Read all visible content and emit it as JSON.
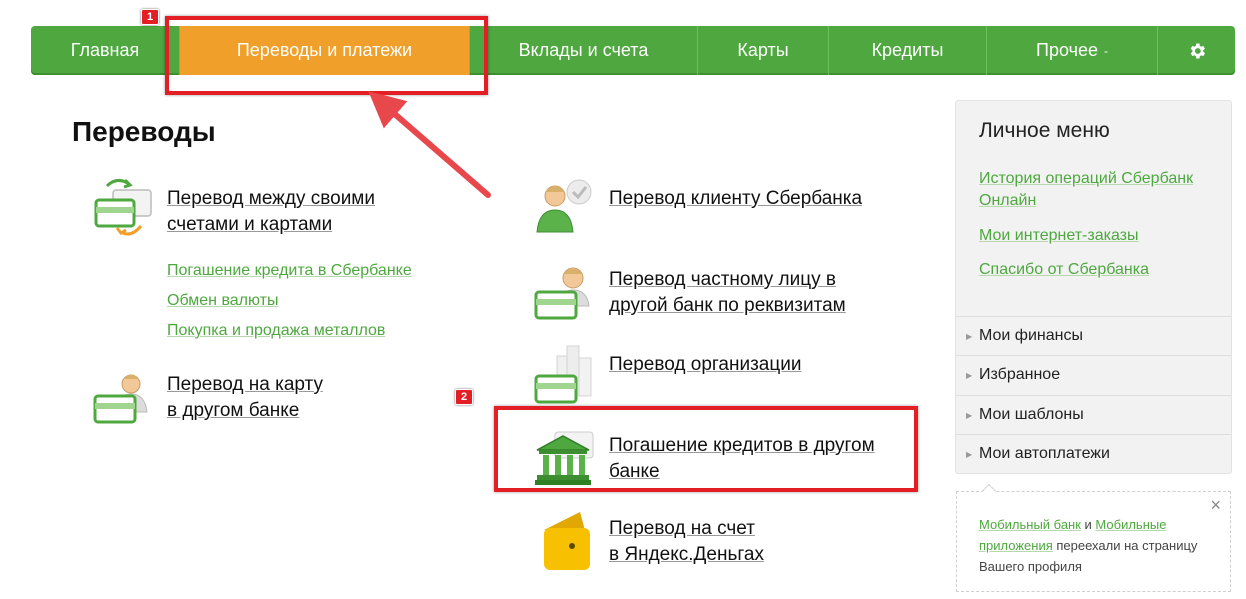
{
  "nav": {
    "items": [
      {
        "label": "Главная"
      },
      {
        "label": "Переводы и платежи"
      },
      {
        "label": "Вклады и счета"
      },
      {
        "label": "Карты"
      },
      {
        "label": "Кредиты"
      },
      {
        "label": "Прочее"
      }
    ],
    "more_caret": "-",
    "settings_icon": "gear-icon",
    "active_color": "#f0a02a",
    "bar_color": "#4ea83f"
  },
  "annotations": {
    "badge1": "1",
    "badge2": "2",
    "color": "#e31e24"
  },
  "main": {
    "title": "Переводы",
    "left": {
      "own_transfer": [
        "Перевод между своими",
        "счетами и картами"
      ],
      "sub_links": [
        "Погашение кредита в Сбербанке",
        "Обмен валюты",
        "Покупка и продажа металлов"
      ],
      "card_transfer": [
        "Перевод на карту",
        "в другом банке"
      ]
    },
    "right": {
      "client_transfer": "Перевод клиенту Сбербанка",
      "person_transfer": [
        "Перевод частному лицу в",
        "другой банк по реквизитам"
      ],
      "org_transfer": "Перевод организации",
      "loan_repay": [
        "Погашение кредитов в другом",
        "банке"
      ],
      "yandex": [
        "Перевод на счет",
        "в Яндекс.Деньгах"
      ]
    }
  },
  "sidebar": {
    "title": "Личное меню",
    "links": [
      "История операций Сбербанк Онлайн",
      "Мои интернет-заказы",
      "Спасибо от Сбербанка"
    ],
    "rows": [
      "Мои финансы",
      "Избранное",
      "Мои шаблоны",
      "Мои автоплатежи"
    ]
  },
  "notice": {
    "link1": "Мобильный банк",
    "and": " и ",
    "link2": "Мобильные приложения",
    "rest": " переехали на страницу Вашего профиля",
    "close": "×"
  }
}
